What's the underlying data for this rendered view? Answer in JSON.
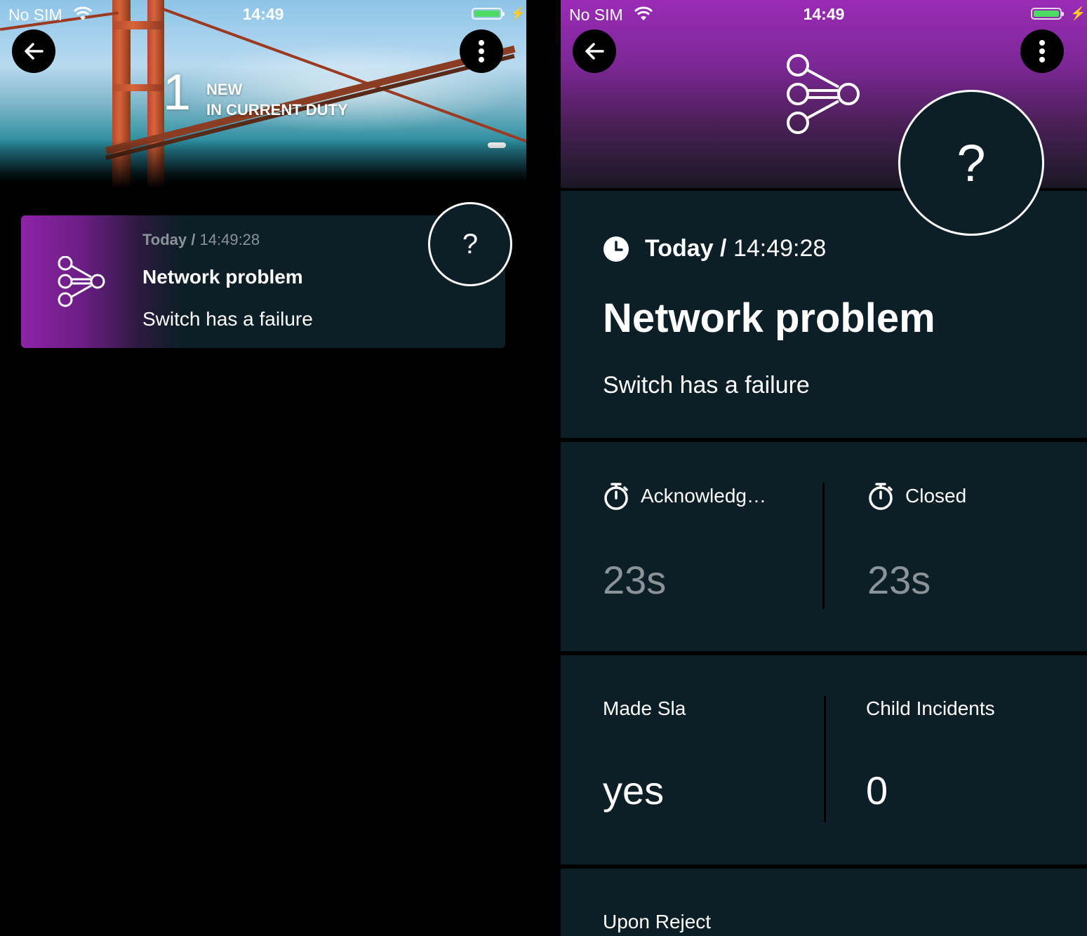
{
  "status_bar": {
    "carrier": "No SIM",
    "time": "14:49"
  },
  "left_screen": {
    "header": {
      "count": "1",
      "label_line1": "NEW",
      "label_line2": "IN CURRENT DUTY"
    },
    "card": {
      "date_prefix": "Today /",
      "time": "14:49:28",
      "title": "Network problem",
      "subtitle": "Switch has a failure",
      "help_symbol": "?"
    }
  },
  "right_screen": {
    "help_symbol": "?",
    "date_prefix": "Today /",
    "time": "14:49:28",
    "title": "Network problem",
    "subtitle": "Switch has a failure",
    "stats_row1": [
      {
        "label": "Acknowledg…",
        "value": "23s",
        "icon": "stopwatch-icon"
      },
      {
        "label": "Closed",
        "value": "23s",
        "icon": "stopwatch-icon"
      }
    ],
    "stats_row2": [
      {
        "label": "Made Sla",
        "value": "yes"
      },
      {
        "label": "Child Incidents",
        "value": "0"
      }
    ],
    "upon_reject_label": "Upon Reject"
  },
  "colors": {
    "accent_purple": "#9a2bb5",
    "panel_bg": "#0c1e26",
    "battery_green": "#4cd964",
    "dim_text": "#8a9398"
  }
}
